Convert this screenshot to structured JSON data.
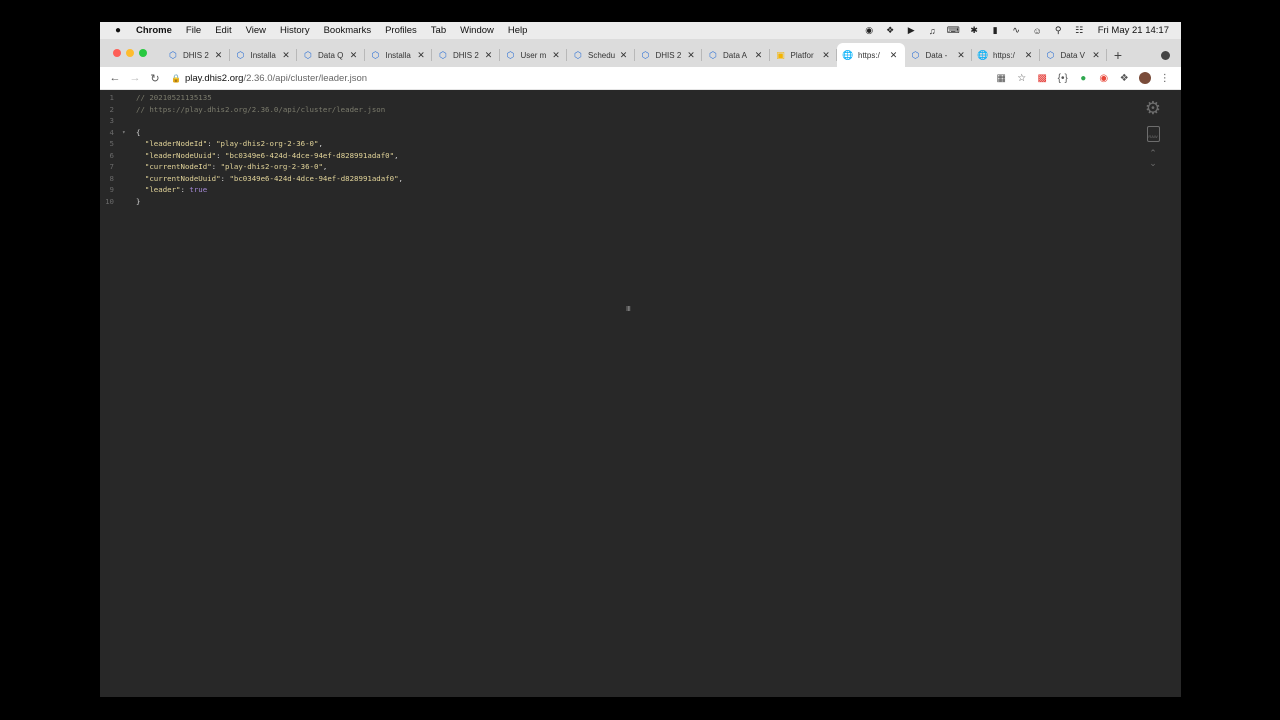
{
  "menubar": {
    "app_name": "Chrome",
    "items": [
      "File",
      "Edit",
      "View",
      "History",
      "Bookmarks",
      "Profiles",
      "Tab",
      "Window",
      "Help"
    ],
    "clock": "Fri May 21  14:17"
  },
  "tabs": [
    {
      "title": "DHIS 2",
      "icon": "dhis2-icon"
    },
    {
      "title": "Installa",
      "icon": "dhis2-icon"
    },
    {
      "title": "Data Q",
      "icon": "dhis2-icon"
    },
    {
      "title": "Installa",
      "icon": "dhis2-icon"
    },
    {
      "title": "DHIS 2",
      "icon": "dhis2-icon"
    },
    {
      "title": "User m",
      "icon": "dhis2-icon"
    },
    {
      "title": "Schedu",
      "icon": "dhis2-icon"
    },
    {
      "title": "DHIS 2",
      "icon": "dhis2-icon"
    },
    {
      "title": "Data A",
      "icon": "dhis2-icon"
    },
    {
      "title": "Platfor",
      "icon": "slides-icon"
    },
    {
      "title": "https:/",
      "icon": "globe-icon",
      "active": true
    },
    {
      "title": "Data -",
      "icon": "dhis2-icon"
    },
    {
      "title": "https:/",
      "icon": "globe-icon"
    },
    {
      "title": "Data V",
      "icon": "dhis2-icon"
    }
  ],
  "toolbar": {
    "url_host": "play.dhis2.org",
    "url_path": "/2.36.0/api/cluster/leader.json"
  },
  "json_view": {
    "lines": [
      {
        "n": "1",
        "fold": "",
        "parts": [
          {
            "t": "// 20210521135135",
            "c": "comment"
          }
        ]
      },
      {
        "n": "2",
        "fold": "",
        "parts": [
          {
            "t": "// https://play.dhis2.org/2.36.0/api/cluster/leader.json",
            "c": "comment"
          }
        ]
      },
      {
        "n": "3",
        "fold": "",
        "parts": []
      },
      {
        "n": "4",
        "fold": "▾",
        "parts": [
          {
            "t": "{",
            "c": "punct"
          }
        ]
      },
      {
        "n": "5",
        "fold": "",
        "parts": [
          {
            "t": "  \"leaderNodeId\"",
            "c": "key"
          },
          {
            "t": ": ",
            "c": "punct"
          },
          {
            "t": "\"play-dhis2-org-2-36-0\"",
            "c": "str"
          },
          {
            "t": ",",
            "c": "punct"
          }
        ]
      },
      {
        "n": "6",
        "fold": "",
        "parts": [
          {
            "t": "  \"leaderNodeUuid\"",
            "c": "key"
          },
          {
            "t": ": ",
            "c": "punct"
          },
          {
            "t": "\"bc0349e6-424d-4dce-94ef-d828991adaf0\"",
            "c": "str"
          },
          {
            "t": ",",
            "c": "punct"
          }
        ]
      },
      {
        "n": "7",
        "fold": "",
        "parts": [
          {
            "t": "  \"currentNodeId\"",
            "c": "key"
          },
          {
            "t": ": ",
            "c": "punct"
          },
          {
            "t": "\"play-dhis2-org-2-36-0\"",
            "c": "str"
          },
          {
            "t": ",",
            "c": "punct"
          }
        ]
      },
      {
        "n": "8",
        "fold": "",
        "parts": [
          {
            "t": "  \"currentNodeUuid\"",
            "c": "key"
          },
          {
            "t": ": ",
            "c": "punct"
          },
          {
            "t": "\"bc0349e6-424d-4dce-94ef-d828991adaf0\"",
            "c": "str"
          },
          {
            "t": ",",
            "c": "punct"
          }
        ]
      },
      {
        "n": "9",
        "fold": "",
        "parts": [
          {
            "t": "  \"leader\"",
            "c": "key"
          },
          {
            "t": ": ",
            "c": "punct"
          },
          {
            "t": "true",
            "c": "bool"
          }
        ]
      },
      {
        "n": "10",
        "fold": "",
        "parts": [
          {
            "t": "}",
            "c": "punct"
          }
        ]
      }
    ],
    "raw_label": "RAW"
  },
  "colors": {
    "background": "#282828",
    "string": "#e3d59a",
    "boolean": "#a58ad6",
    "comment": "#7c7c6d"
  }
}
